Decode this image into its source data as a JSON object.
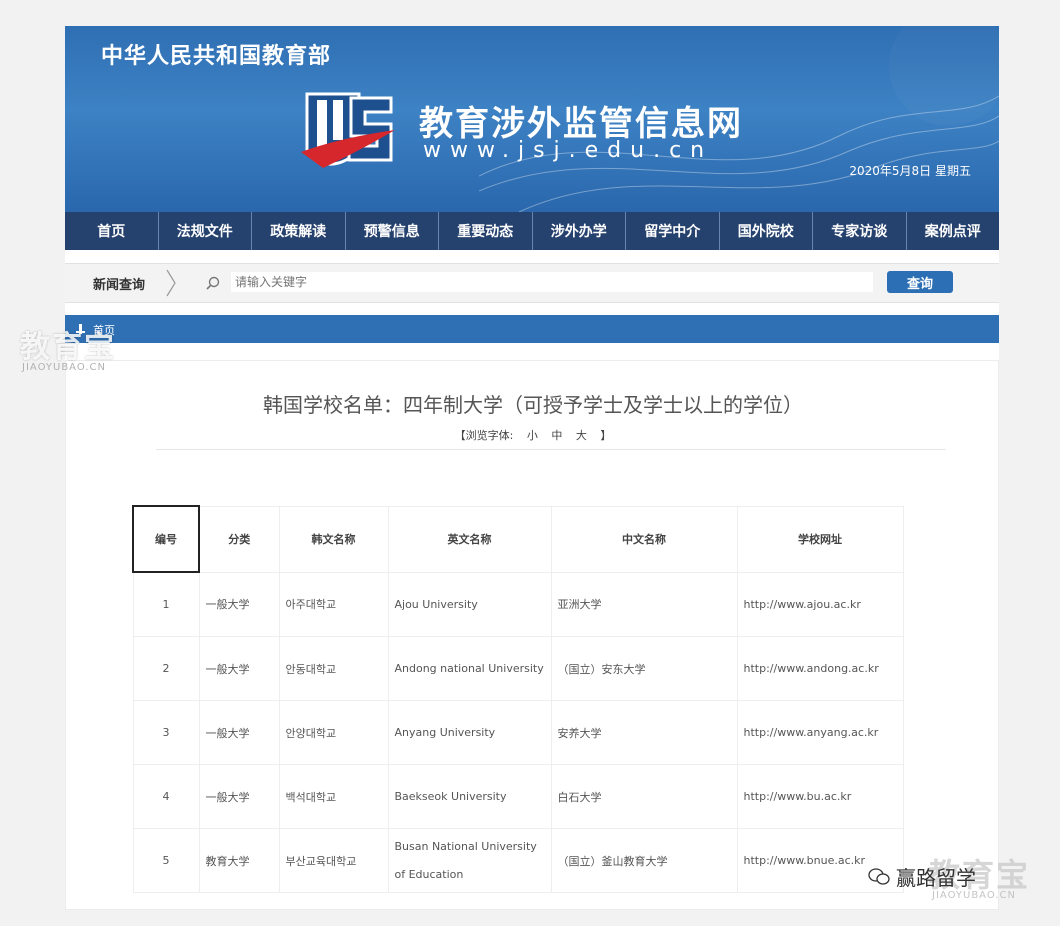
{
  "header": {
    "ministry": "中华人民共和国教育部",
    "site_title": "教育涉外监管信息网",
    "site_url": "www.jsj.edu.cn",
    "date": "2020年5月8日  星期五"
  },
  "nav": [
    "首页",
    "法规文件",
    "政策解读",
    "预警信息",
    "重要动态",
    "涉外办学",
    "留学中介",
    "国外院校",
    "专家访谈",
    "案例点评"
  ],
  "search": {
    "label": "新闻查询",
    "placeholder": "请输入关键字",
    "button": "查询"
  },
  "breadcrumb": "首页",
  "article": {
    "title": "韩国学校名单：四年制大学（可授予学士及学士以上的学位）",
    "font_switch": {
      "prefix": "【浏览字体:",
      "small": "小",
      "medium": "中",
      "large": "大",
      "suffix": "】"
    }
  },
  "table": {
    "headers": [
      "编号",
      "分类",
      "韩文名称",
      "英文名称",
      "中文名称",
      "学校网址"
    ],
    "rows": [
      [
        "1",
        "一般大学",
        "아주대학교",
        "Ajou  University",
        "亚洲大学",
        "http://www.ajou.ac.kr"
      ],
      [
        "2",
        "一般大学",
        "안동대학교",
        "Andong national  University",
        "（国立）安东大学",
        "http://www.andong.ac.kr"
      ],
      [
        "3",
        "一般大学",
        "안양대학교",
        "Anyang  University",
        "安养大学",
        "http://www.anyang.ac.kr"
      ],
      [
        "4",
        "一般大学",
        "백석대학교",
        "Baekseok  University",
        "白石大学",
        "http://www.bu.ac.kr"
      ],
      [
        "5",
        "教育大学",
        "부산교육대학교",
        "Busan National  University of Education",
        "（国立）釜山教育大学",
        "http://www.bnue.ac.kr"
      ]
    ]
  },
  "watermarks": {
    "brand": "教育宝",
    "brand_url": "JIAOYUBAO.CN",
    "wechat_account": "赢路留学"
  },
  "colors": {
    "banner": "#2f6fb3",
    "nav": "#25416e",
    "button": "#2d6fb5",
    "logo_red": "#d6272c"
  },
  "icons": [
    "logo-shield-icon",
    "search-icon",
    "home-icon",
    "wechat-icon"
  ]
}
